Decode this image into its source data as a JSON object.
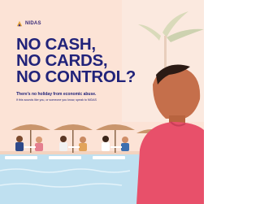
{
  "brand": {
    "name": "NIDAS",
    "logo_icon": "nidas-logo-icon"
  },
  "headline": {
    "line1": "NO CASH,",
    "line2": "NO CARDS,",
    "line3": "NO CONTROL?"
  },
  "subhead": "There's no holiday from economic abuse.",
  "body": "If this sounds like you, or someone you know, speak to NIDAS",
  "colors": {
    "background": "#fce3d6",
    "headline": "#21237a",
    "sea": "#bfe0f0",
    "umbrella": "#c9956c",
    "shirt": "#e8506a"
  }
}
